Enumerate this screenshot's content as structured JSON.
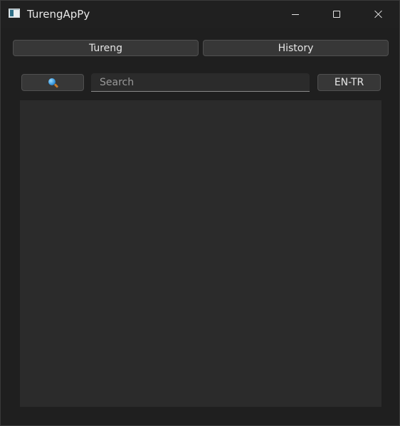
{
  "window": {
    "title": "TurengApPy"
  },
  "tabs": [
    {
      "label": "Tureng"
    },
    {
      "label": "History"
    }
  ],
  "search": {
    "button_icon": "magnifier-icon",
    "placeholder": "Search",
    "value": "",
    "language_label": "EN-TR"
  },
  "colors": {
    "window_bg": "#1f1f1f",
    "button_bg": "#373737",
    "panel_bg": "#2b2b2b",
    "text": "#e6e6e6"
  }
}
